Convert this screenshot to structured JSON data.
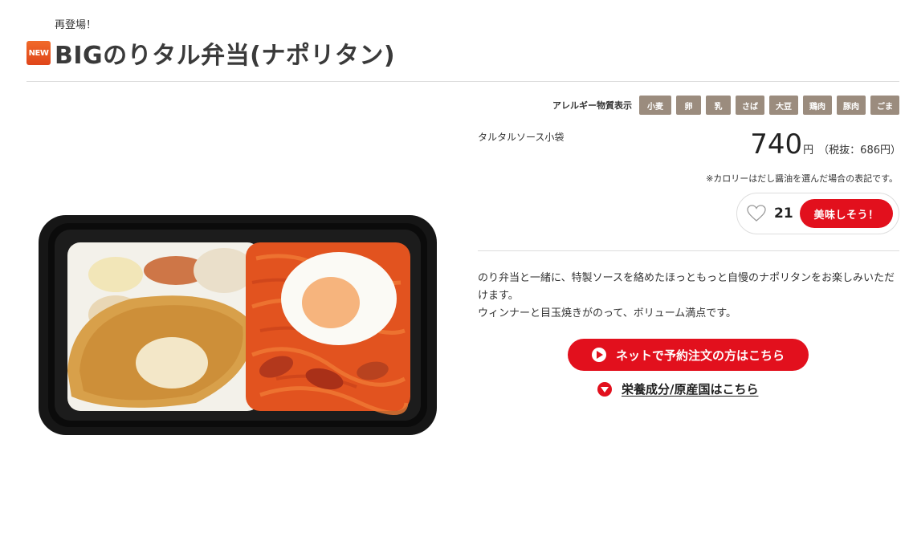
{
  "header": {
    "subtitle": "再登場！",
    "new_badge": "NEW",
    "title": "BIGのりタル弁当(ナポリタン)"
  },
  "allergy": {
    "label": "アレルギー物質表示",
    "tags": [
      "小麦",
      "卵",
      "乳",
      "さば",
      "大豆",
      "鶏肉",
      "豚肉",
      "ごま"
    ]
  },
  "product": {
    "sauce_note": "タルタルソース小袋",
    "price": "740",
    "price_unit": "円",
    "price_tax": "（税抜：686円）",
    "calorie_note": "※カロリーはだし醤油を選んだ場合の表記です。"
  },
  "like": {
    "count": "21",
    "button_label": "美味しそう！"
  },
  "description": {
    "line1": "のり弁当と一緒に、特製ソースを絡めたほっともっと自慢のナポリタンをお楽しみいただけます。",
    "line2": "ウィンナーと目玉焼きがのって、ボリューム満点です。"
  },
  "actions": {
    "order_label": "ネットで予約注文の方はこちら",
    "nutrition_label": "栄養成分/原産国はこちら"
  },
  "colors": {
    "accent_red": "#e2101d",
    "allergy_tag": "#9b8c7e",
    "new_badge": "#e0451a"
  }
}
